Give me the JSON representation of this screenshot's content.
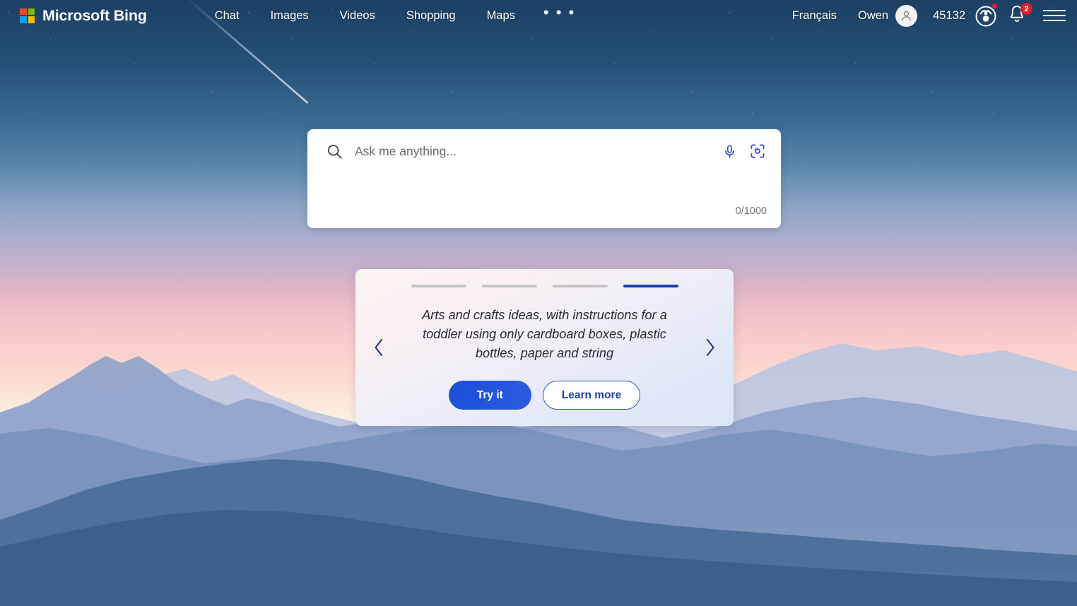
{
  "header": {
    "brand_name": "Microsoft Bing",
    "logo_icon": "microsoft-logo-icon",
    "logo_colors": {
      "top_left": "#f25022",
      "top_right": "#7fba00",
      "bottom_left": "#00a4ef",
      "bottom_right": "#ffb900"
    },
    "nav": [
      {
        "label": "Chat"
      },
      {
        "label": "Images"
      },
      {
        "label": "Videos"
      },
      {
        "label": "Shopping"
      },
      {
        "label": "Maps"
      }
    ],
    "more_label": "• • •",
    "language": "Français",
    "user_name": "Owen",
    "avatar_icon": "person-icon",
    "rewards_points": "45132",
    "rewards_icon": "rewards-medal-icon",
    "notifications_icon": "bell-icon",
    "notifications_count": "2",
    "menu_icon": "hamburger-menu-icon",
    "badge_color": "#d8232f"
  },
  "search": {
    "search_icon": "search-icon",
    "placeholder": "Ask me anything...",
    "value": "",
    "mic_icon": "microphone-icon",
    "lens_icon": "visual-search-icon",
    "char_count": "0/1000",
    "accent": "#2b4fc8"
  },
  "promo": {
    "text": "Arts and crafts ideas, with instructions for a toddler using only cardboard boxes, plastic bottles, paper and string",
    "primary_label": "Try it",
    "secondary_label": "Learn more",
    "prev_icon": "chevron-left-icon",
    "next_icon": "chevron-right-icon",
    "pips": [
      {
        "active": false
      },
      {
        "active": false
      },
      {
        "active": false
      },
      {
        "active": true
      }
    ],
    "active_pip_color": "#1740a8",
    "inactive_pip_color": "#c4c4c4"
  },
  "background": {
    "scene": "mountain-sunset-starry-sky",
    "sky_top": "#1d3f64",
    "sky_mid": "#c3b0cc",
    "sky_glow": "#fdf4ea",
    "mountain_far": "#b9c2de",
    "mountain_near": "#3f6089",
    "shooting_star_icon": "shooting-star-icon"
  }
}
